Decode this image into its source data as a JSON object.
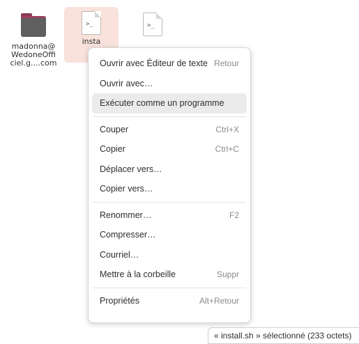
{
  "files": {
    "folder": {
      "label_line1": "madonna@",
      "label_line2": "WedoneOffi",
      "label_line3": "ciel.g....com",
      "icon": "folder-icon"
    },
    "install": {
      "label": "insta",
      "icon": "script-file-icon",
      "prompt": ">_"
    },
    "other": {
      "label": "",
      "icon": "script-file-icon",
      "prompt": ">_"
    }
  },
  "menu": {
    "open_with_editor": {
      "label": "Ouvrir avec Éditeur de texte",
      "accel": "Retour"
    },
    "open_with": {
      "label": "Ouvrir avec…"
    },
    "run_program": {
      "label": "Exécuter comme un programme"
    },
    "cut": {
      "label": "Couper",
      "accel": "Ctrl+X"
    },
    "copy": {
      "label": "Copier",
      "accel": "Ctrl+C"
    },
    "move_to": {
      "label": "Déplacer vers…"
    },
    "copy_to": {
      "label": "Copier vers…"
    },
    "rename": {
      "label": "Renommer…",
      "accel": "F2"
    },
    "compress": {
      "label": "Compresser…"
    },
    "email": {
      "label": "Courriel…"
    },
    "trash": {
      "label": "Mettre à la corbeille",
      "accel": "Suppr"
    },
    "properties": {
      "label": "Propriétés",
      "accel": "Alt+Retour"
    }
  },
  "status": {
    "text": "« install.sh » sélectionné (233 octets)"
  },
  "colors": {
    "selection": "#f9e2db",
    "hover": "#ebebeb",
    "folder_body": "#5f5f5f",
    "folder_accent": "#9b3f61"
  }
}
